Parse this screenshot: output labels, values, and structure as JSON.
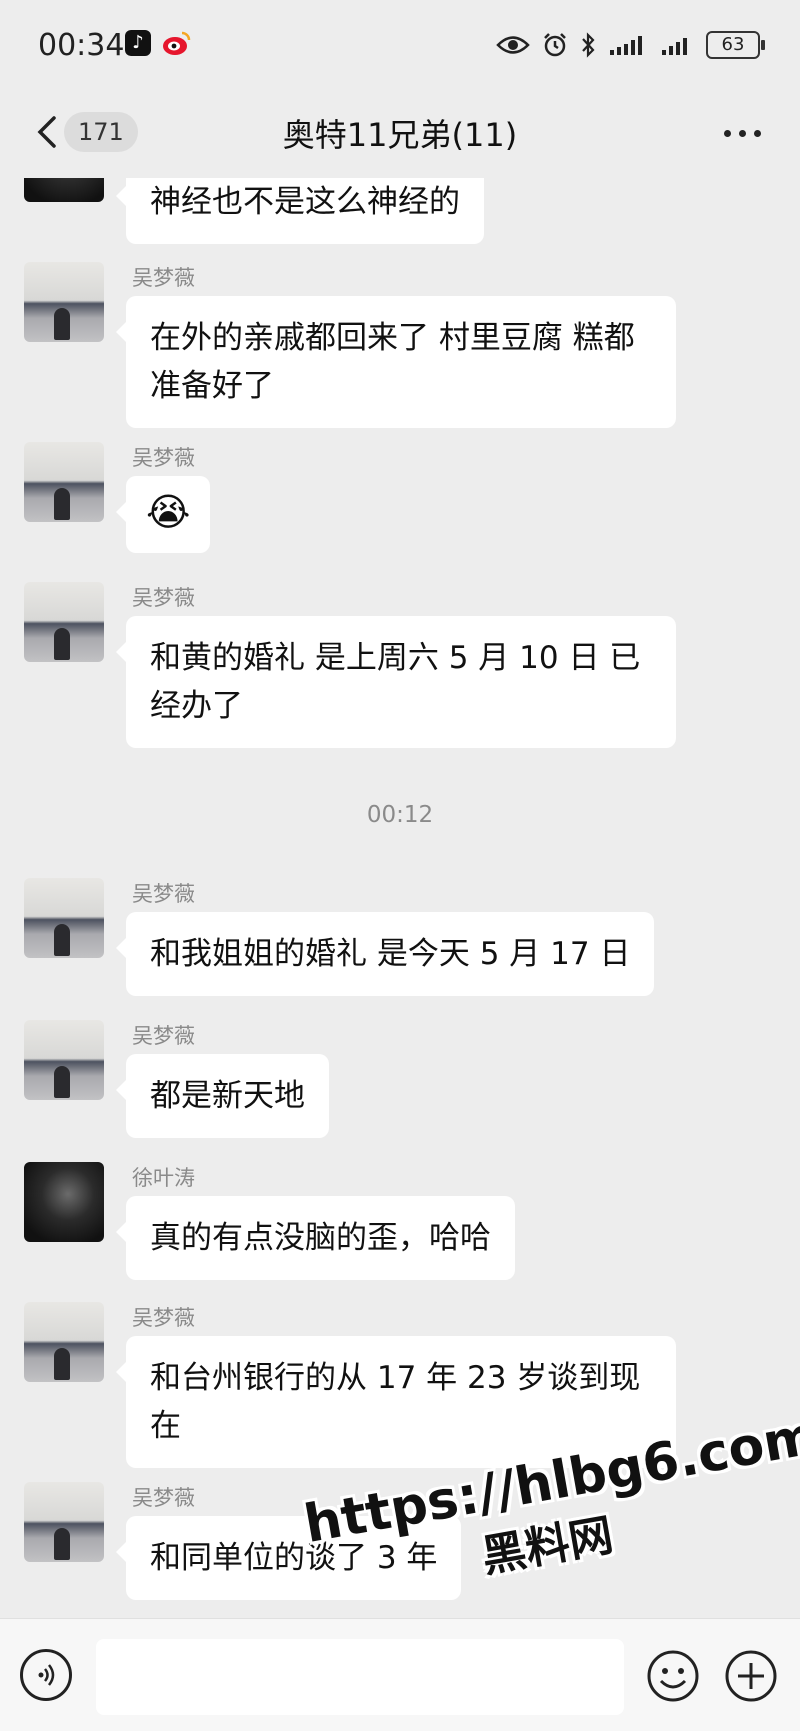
{
  "status_bar": {
    "time": "00:34",
    "battery": "63",
    "apps": [
      "tiktok-icon",
      "weibo-icon"
    ],
    "indicators": [
      "eye-icon",
      "alarm-icon",
      "bluetooth-icon",
      "signal-icon",
      "signal-icon"
    ]
  },
  "header": {
    "back_count": "171",
    "title": "奥特11兄弟(11)"
  },
  "messages": [
    {
      "sender": "",
      "text": "神经也不是这么神经的",
      "avatar": "lake"
    },
    {
      "sender": "吴梦薇",
      "text": "在外的亲戚都回来了 村里豆腐 糕都准备好了",
      "avatar": "lake"
    },
    {
      "sender": "吴梦薇",
      "text": "😭",
      "avatar": "lake",
      "is_emoji": true
    },
    {
      "sender": "吴梦薇",
      "text": "和黄的婚礼 是上周六 5 月 10 日 已经办了",
      "avatar": "lake"
    },
    {
      "sender": "吴梦薇",
      "text": "和我姐姐的婚礼 是今天 5 月 17 日",
      "avatar": "lake"
    },
    {
      "sender": "吴梦薇",
      "text": "都是新天地",
      "avatar": "lake"
    },
    {
      "sender": "徐叶涛",
      "text": "真的有点没脑的歪，哈哈",
      "avatar": "dark"
    },
    {
      "sender": "吴梦薇",
      "text": "和台州银行的从 17 年 23 岁谈到现在",
      "avatar": "lake"
    },
    {
      "sender": "吴梦薇",
      "text": "和同单位的谈了 3 年",
      "avatar": "lake"
    }
  ],
  "timestamp": "00:12",
  "input_bar": {
    "placeholder": ""
  },
  "watermark": {
    "url": "https://hlbg6.com",
    "name": "黑料网"
  },
  "colors": {
    "background": "#ededed",
    "bubble": "#ffffff",
    "sender": "#8a8a8a"
  }
}
